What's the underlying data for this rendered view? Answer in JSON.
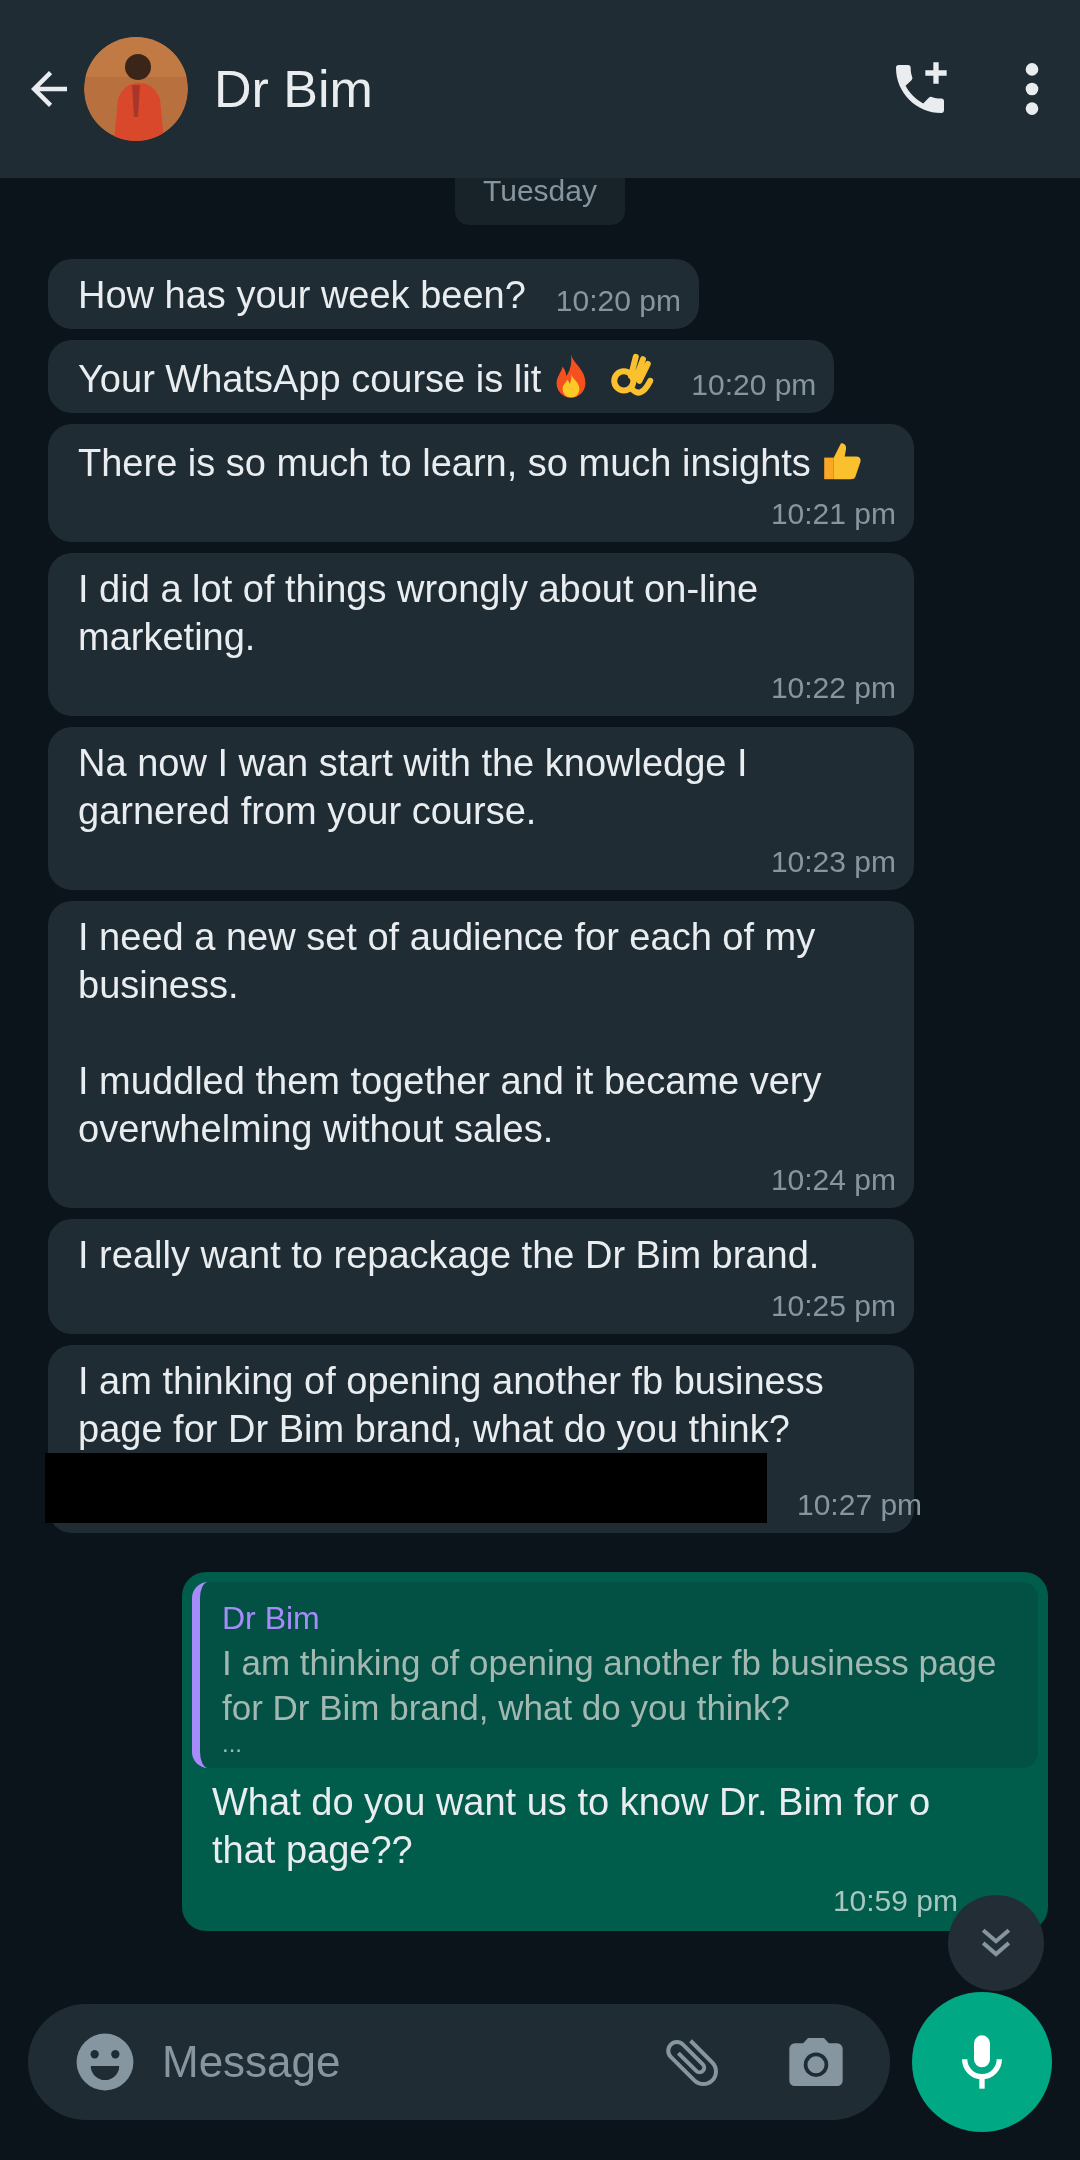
{
  "header": {
    "title": "Dr Bim"
  },
  "date_chip": "Tuesday",
  "messages": [
    {
      "kind": "incoming",
      "text": "How has your week been?",
      "time": "10:20 pm"
    },
    {
      "kind": "incoming",
      "text": "Your WhatsApp course is lit",
      "emoji": [
        {
          "kind": "fire"
        },
        {
          "kind": "ok-hand"
        }
      ],
      "time": "10:20 pm"
    },
    {
      "kind": "incoming",
      "text": "There is so much to learn, so much insights",
      "emoji": [
        {
          "kind": "thumbs-up"
        }
      ],
      "time": "10:21 pm"
    },
    {
      "kind": "incoming",
      "text": "I did a lot of things wrongly about on-line marketing.",
      "time": "10:22 pm"
    },
    {
      "kind": "incoming",
      "text": "Na now I wan start with the knowledge I garnered from your course.",
      "time": "10:23 pm"
    },
    {
      "kind": "incoming",
      "text": "I need a new set of audience for each of my business.\n\nI muddled them together and it became very overwhelming without sales.",
      "time": "10:24 pm"
    },
    {
      "kind": "incoming",
      "text": "I really want to repackage the Dr Bim brand.",
      "time": "10:25 pm"
    },
    {
      "kind": "incoming",
      "text": "I am thinking of opening another fb business page for Dr Bim brand, what do you think?",
      "redacted": true,
      "time": "10:27 pm"
    },
    {
      "kind": "outgoing",
      "quote": {
        "author": "Dr Bim",
        "text": "I am thinking of opening another fb business page for Dr Bim brand, what do you think?",
        "more": "..."
      },
      "text": "What do you want us to know Dr. Bim for o\nthat page??",
      "time": "10:59 pm"
    }
  ],
  "composer": {
    "placeholder": "Message"
  }
}
